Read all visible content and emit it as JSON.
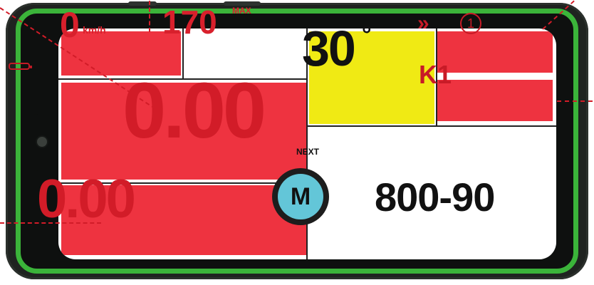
{
  "speed": {
    "value": "0",
    "unit": "km/h"
  },
  "max": {
    "value": "170",
    "label": "MAX"
  },
  "main_value": "0.00",
  "secondary_value": "0.00",
  "angle": {
    "value": "30",
    "degree_symbol": "°"
  },
  "status": {
    "ff_symbol": "»",
    "ff_number": "1",
    "k_value": "K1"
  },
  "next": {
    "label": "NEXT",
    "mode_letter": "M",
    "code": "800-90"
  },
  "icons": [
    "battery-icon",
    "fast-forward-icon",
    "numbered-circle-icon",
    "mode-m-icon"
  ],
  "colors": {
    "red_panel": "#ee3340",
    "red_text": "#d21c28",
    "yellow": "#f0ea14",
    "cyan": "#63c6d8",
    "green_bezel": "#3bb43a"
  }
}
